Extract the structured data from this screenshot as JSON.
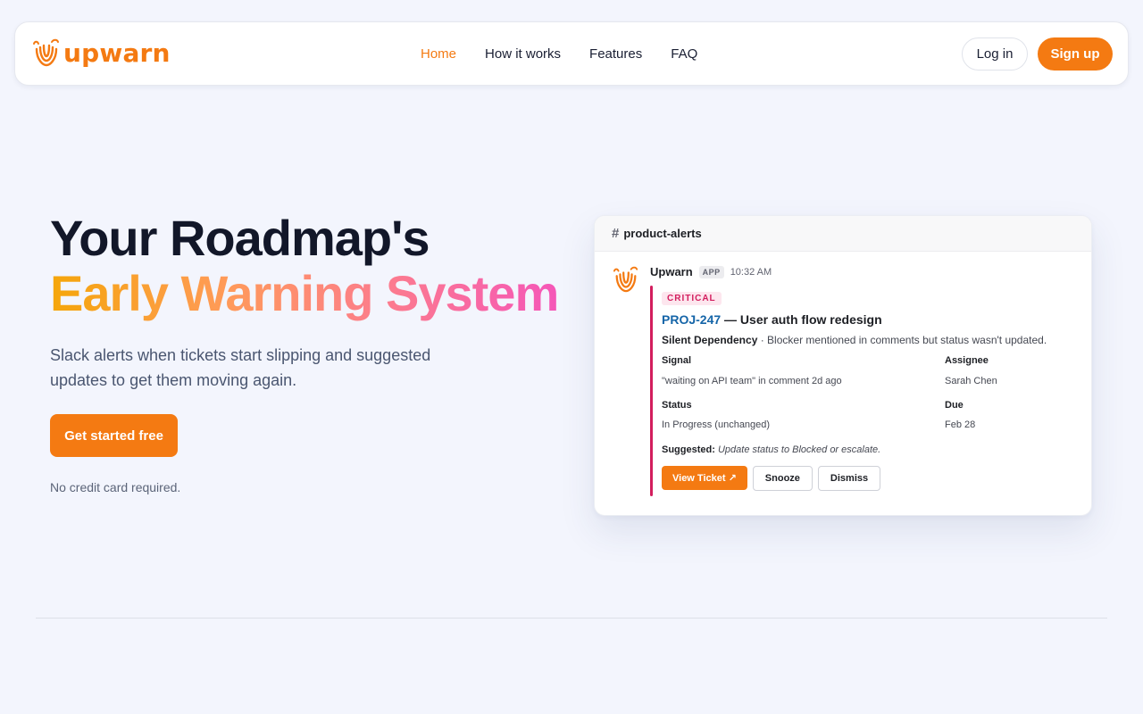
{
  "nav": {
    "brand": "upwarn",
    "links": [
      {
        "label": "Home",
        "active": true
      },
      {
        "label": "How it works",
        "active": false
      },
      {
        "label": "Features",
        "active": false
      },
      {
        "label": "FAQ",
        "active": false
      }
    ],
    "login_label": "Log in",
    "signup_label": "Sign up"
  },
  "hero": {
    "headline_line1": "Your Roadmap's",
    "headline_line2": "Early Warning System",
    "subtitle": "Slack alerts when tickets start slipping and suggested updates to get them moving again.",
    "cta_label": "Get started free",
    "note": "No credit card required."
  },
  "slack": {
    "channel_hash": "#",
    "channel": "product-alerts",
    "author": "Upwarn",
    "app_tag": "APP",
    "time": "10:32 AM",
    "severity": "CRITICAL",
    "ticket_key": "PROJ-247",
    "ticket_title": " — User auth flow redesign",
    "type": "Silent Dependency",
    "type_sep": " · ",
    "description": "Blocker mentioned in comments but status wasn't updated.",
    "fields": {
      "signal_label": "Signal",
      "signal_value": "\"waiting on API team\" in comment 2d ago",
      "assignee_label": "Assignee",
      "assignee_value": "Sarah Chen",
      "status_label": "Status",
      "status_value": "In Progress (unchanged)",
      "due_label": "Due",
      "due_value": "Feb 28"
    },
    "suggested_label": "Suggested:",
    "suggested_text": "Update status to Blocked or escalate.",
    "buttons": {
      "view": "View Ticket ↗",
      "snooze": "Snooze",
      "dismiss": "Dismiss"
    }
  },
  "colors": {
    "brand_orange": "#f47a12",
    "critical": "#d31e5e",
    "ticket_link": "#1565a8"
  },
  "icons": [
    "upwarn-logo-icon",
    "hash-icon",
    "external-link-icon"
  ]
}
